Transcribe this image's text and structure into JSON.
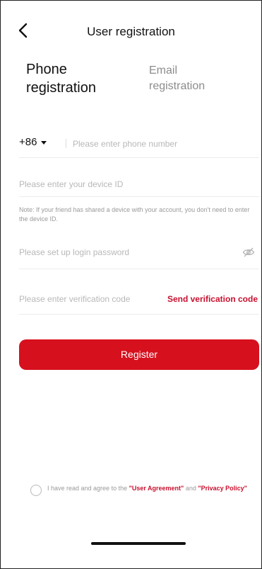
{
  "header": {
    "title": "User registration",
    "back_icon": "chevron-left-icon"
  },
  "tabs": {
    "phone": "Phone registration",
    "email": "Email registration",
    "active": "phone"
  },
  "form": {
    "country_code": "+86",
    "phone_placeholder": "Please enter phone number",
    "device_placeholder": "Please enter your device ID",
    "device_note": "Note: If your friend has shared a device with your account, you don't need to enter the device ID.",
    "password_placeholder": "Please set up login password",
    "password_toggle_icon": "eye-off-icon",
    "code_placeholder": "Please enter verification code",
    "send_code_label": "Send verification code"
  },
  "register": {
    "label": "Register"
  },
  "agreement": {
    "prefix": "I have read and agree to the ",
    "user_agreement": "\"User Agreement\"",
    "and": " and ",
    "privacy_policy": "\"Privacy Policy\"",
    "checked": false
  },
  "colors": {
    "accent": "#d7101e",
    "link": "#c8102e"
  }
}
